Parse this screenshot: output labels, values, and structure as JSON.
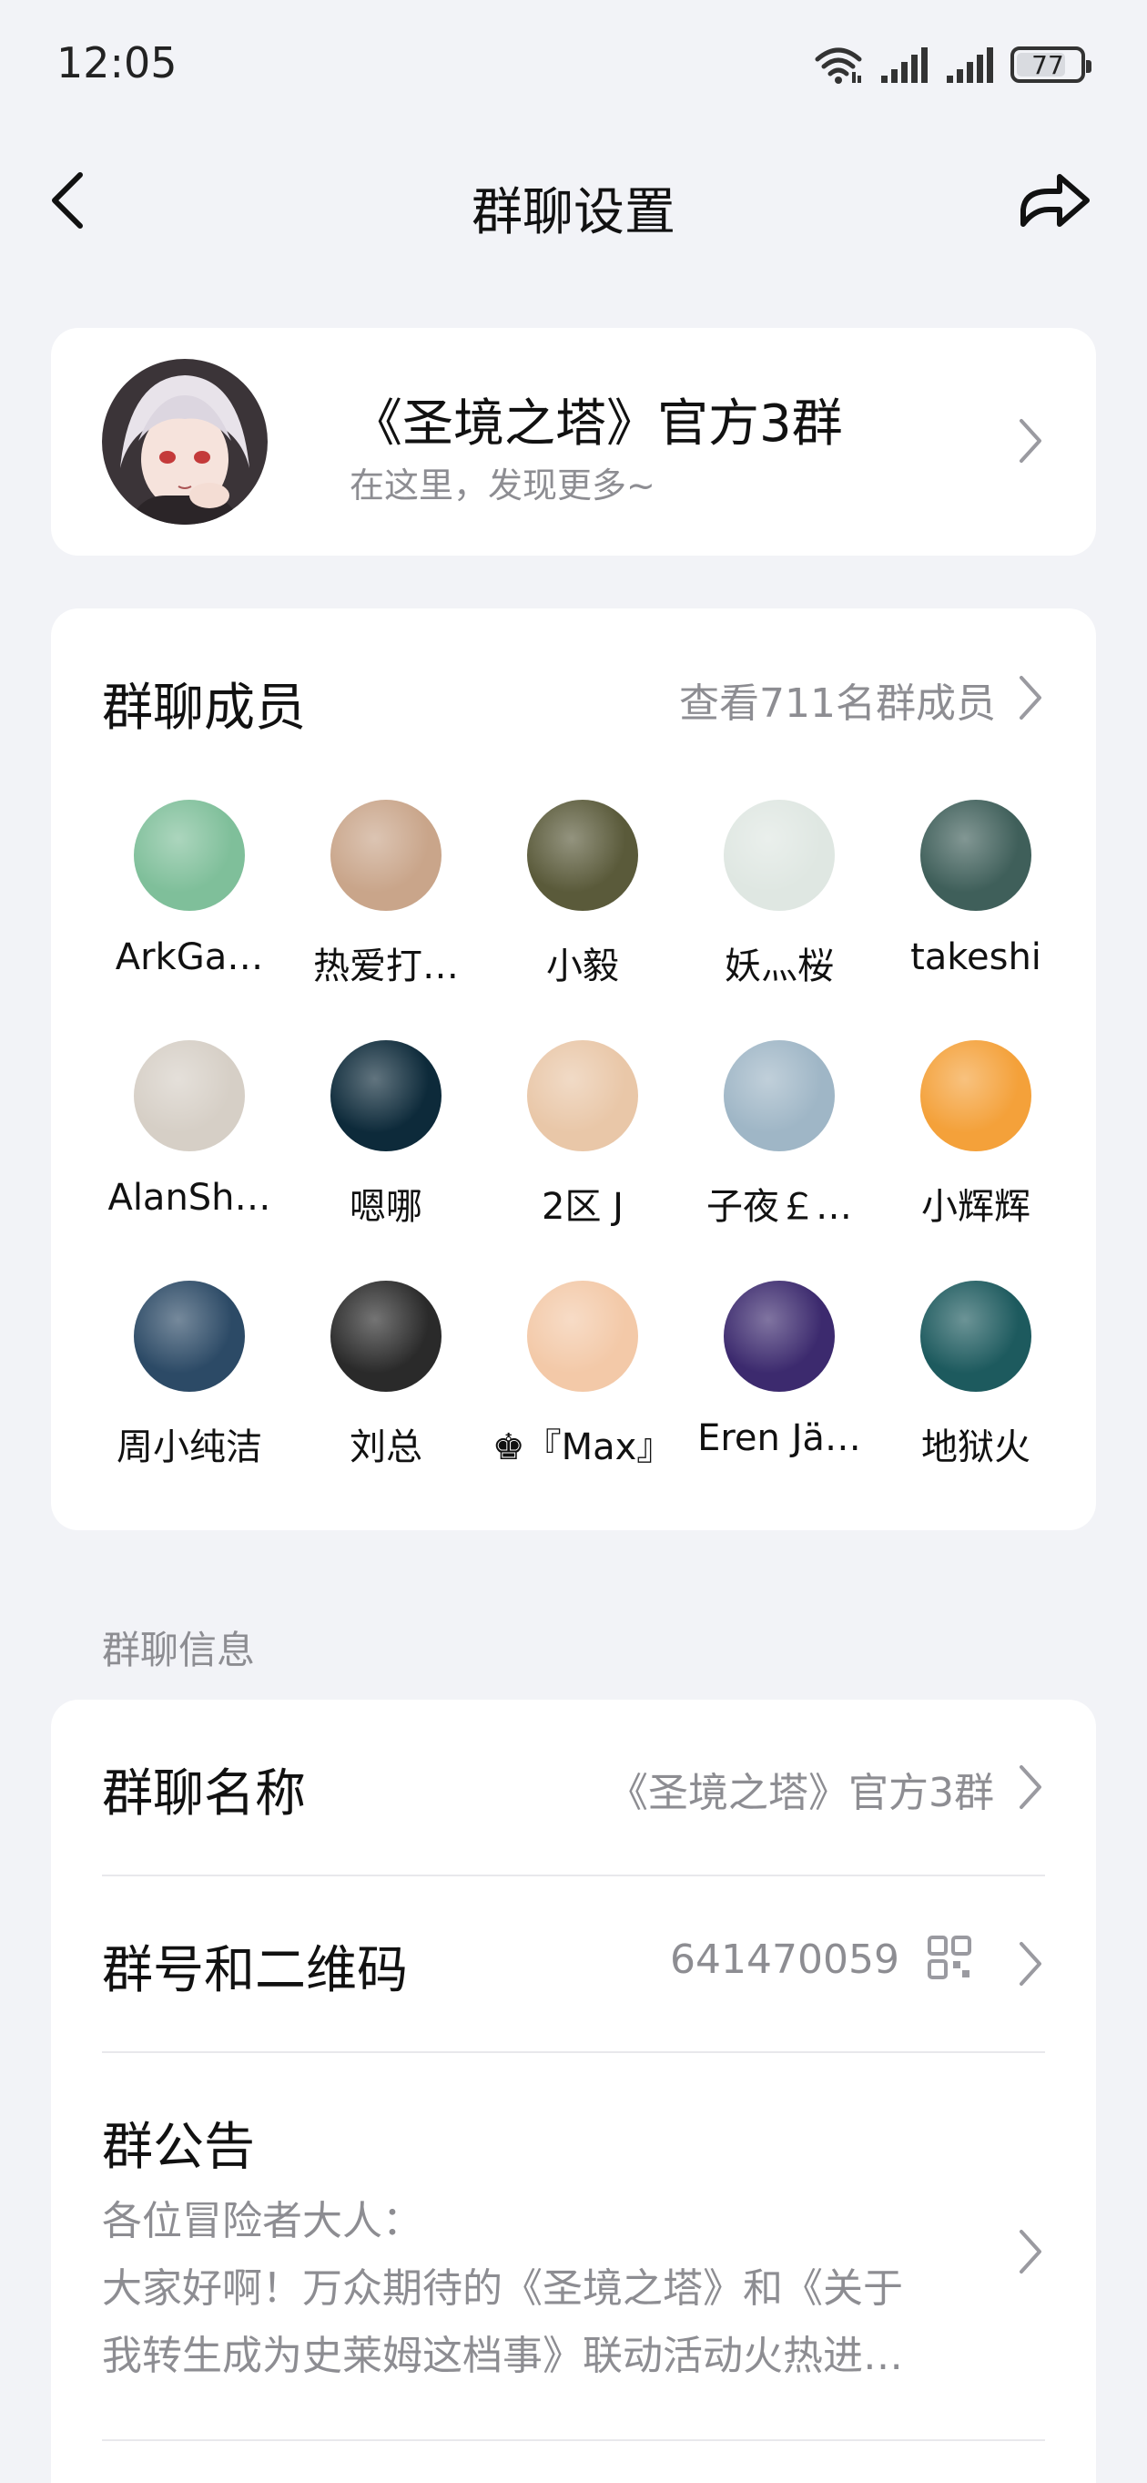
{
  "status_bar": {
    "time": "12:05",
    "battery": "77",
    "icons": [
      "wifi-icon",
      "signal-icon",
      "signal-icon",
      "battery-icon"
    ]
  },
  "nav": {
    "title": "群聊设置",
    "back_icon": "chevron-left-icon",
    "share_icon": "share-icon"
  },
  "group": {
    "name": "《圣境之塔》官方3群",
    "subtitle": "在这里，发现更多~"
  },
  "members": {
    "title": "群聊成员",
    "view_all": "查看711名群成员",
    "list": [
      {
        "name": "ArkGa…",
        "color": "#7fbf9a"
      },
      {
        "name": "热爱打…",
        "color": "#c9a58a"
      },
      {
        "name": "小毅",
        "color": "#5a5a3a"
      },
      {
        "name": "妖灬桜",
        "color": "#dfe7e2"
      },
      {
        "name": "takeshi",
        "color": "#3f5f5a"
      },
      {
        "name": "AlanSh…",
        "color": "#d6cfc6"
      },
      {
        "name": "嗯哪",
        "color": "#0d2a3a"
      },
      {
        "name": "2区 J",
        "color": "#e9c7a8"
      },
      {
        "name": "子夜￡…",
        "color": "#9fb6c6"
      },
      {
        "name": "小辉辉",
        "color": "#f4a13a"
      },
      {
        "name": "周小纯洁",
        "color": "#2c4a66"
      },
      {
        "name": "刘总",
        "color": "#2a2a2a"
      },
      {
        "name": "♚『Max』",
        "color": "#f3c9a8"
      },
      {
        "name": "Eren Jä…",
        "color": "#3c2a6e"
      },
      {
        "name": "地狱火",
        "color": "#1d5a5e"
      }
    ]
  },
  "info": {
    "section_label": "群聊信息",
    "name_label": "群聊名称",
    "name_value": "《圣境之塔》官方3群",
    "id_label": "群号和二维码",
    "id_value": "641470059",
    "notice_title": "群公告",
    "notice_lines": [
      "各位冒险者大人：",
      "大家好啊！万众期待的《圣境之塔》和《关于",
      "我转生成为史莱姆这档事》联动活动火热进…"
    ]
  }
}
